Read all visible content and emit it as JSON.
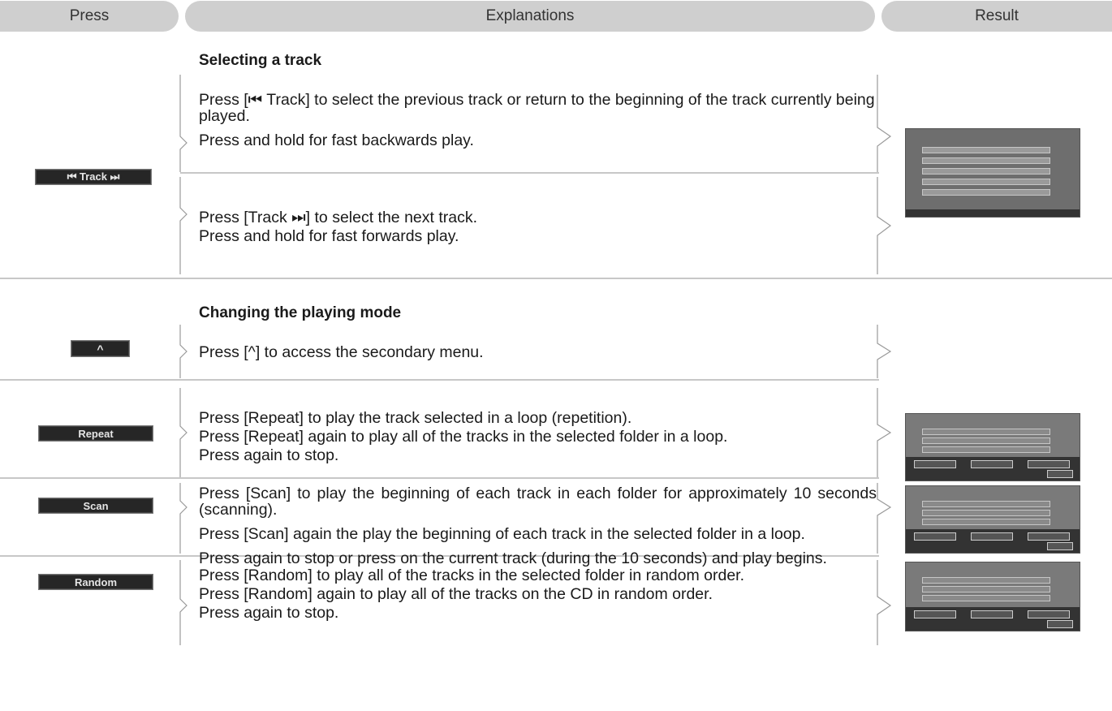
{
  "header": {
    "press": "Press",
    "explanations": "Explanations",
    "result": "Result"
  },
  "sections": {
    "selecting_track": "Selecting a track",
    "playing_mode": "Changing the playing mode"
  },
  "buttons": {
    "track": "⏮ Track ⏭",
    "up": "^",
    "repeat": "Repeat",
    "scan": "Scan",
    "random": "Random"
  },
  "explanations": {
    "prev_track": [
      "Press [⏮ Track] to select the previous track or return to the beginning of the track currently being played.",
      "Press and hold for fast backwards play."
    ],
    "next_track": [
      "Press [Track ⏭] to select the next track.",
      "Press and hold for fast forwards play."
    ],
    "up": "Press [^] to access the secondary menu.",
    "repeat": [
      "Press [Repeat] to play the track selected in a loop (repetition).",
      "Press [Repeat] again to play all of the tracks in the selected folder in a loop.",
      "Press again to stop."
    ],
    "scan": [
      "Press [Scan] to play the beginning of each track in each folder for approximately 10 seconds (scanning).",
      "Press [Scan] again the play the beginning of each track in the selected folder in a loop.",
      "Press again to stop or press on the current track (during the 10 seconds) and play begins."
    ],
    "random": [
      "Press [Random] to play all of the tracks in the selected folder in random order.",
      "Press [Random] again to play all of the tracks on the CD in random order.",
      "Press again to stop."
    ]
  },
  "colors": {
    "header_bg": "#cfcfcf",
    "button_bg": "#262626",
    "divider": "#c7c7c7"
  }
}
